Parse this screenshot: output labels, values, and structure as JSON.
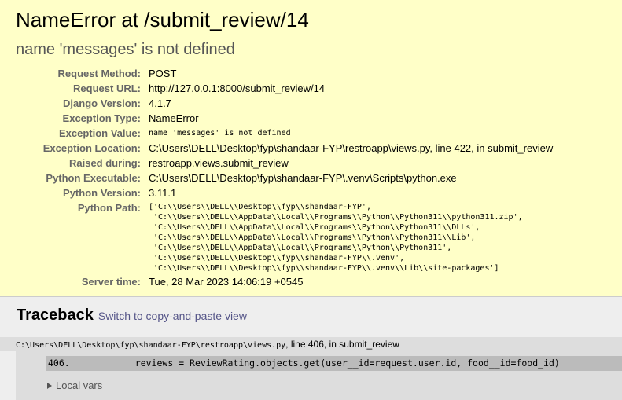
{
  "error": {
    "title": "NameError at /submit_review/14",
    "message": "name 'messages' is not defined"
  },
  "meta": [
    {
      "label": "Request Method:",
      "value": "POST",
      "mono": false
    },
    {
      "label": "Request URL:",
      "value": "http://127.0.0.1:8000/submit_review/14",
      "mono": false
    },
    {
      "label": "Django Version:",
      "value": "4.1.7",
      "mono": false
    },
    {
      "label": "Exception Type:",
      "value": "NameError",
      "mono": false
    },
    {
      "label": "Exception Value:",
      "value": "name 'messages' is not defined",
      "mono": true
    },
    {
      "label": "Exception Location:",
      "value": "C:\\Users\\DELL\\Desktop\\fyp\\shandaar-FYP\\restroapp\\views.py, line 422, in submit_review",
      "mono": false
    },
    {
      "label": "Raised during:",
      "value": "restroapp.views.submit_review",
      "mono": false
    },
    {
      "label": "Python Executable:",
      "value": "C:\\Users\\DELL\\Desktop\\fyp\\shandaar-FYP\\.venv\\Scripts\\python.exe",
      "mono": false
    },
    {
      "label": "Python Version:",
      "value": "3.11.1",
      "mono": false
    }
  ],
  "python_path": {
    "label": "Python Path:",
    "lines": [
      "['C:\\\\Users\\\\DELL\\\\Desktop\\\\fyp\\\\shandaar-FYP',",
      " 'C:\\\\Users\\\\DELL\\\\AppData\\\\Local\\\\Programs\\\\Python\\\\Python311\\\\python311.zip',",
      " 'C:\\\\Users\\\\DELL\\\\AppData\\\\Local\\\\Programs\\\\Python\\\\Python311\\\\DLLs',",
      " 'C:\\\\Users\\\\DELL\\\\AppData\\\\Local\\\\Programs\\\\Python\\\\Python311\\\\Lib',",
      " 'C:\\\\Users\\\\DELL\\\\AppData\\\\Local\\\\Programs\\\\Python\\\\Python311',",
      " 'C:\\\\Users\\\\DELL\\\\Desktop\\\\fyp\\\\shandaar-FYP\\\\.venv',",
      " 'C:\\\\Users\\\\DELL\\\\Desktop\\\\fyp\\\\shandaar-FYP\\\\.venv\\\\Lib\\\\site-packages']"
    ]
  },
  "server_time": {
    "label": "Server time:",
    "value": "Tue, 28 Mar 2023 14:06:19 +0545"
  },
  "traceback": {
    "heading": "Traceback",
    "switch_link": "Switch to copy-and-paste view",
    "frame": {
      "file": "C:\\Users\\DELL\\Desktop\\fyp\\shandaar-FYP\\restroapp\\views.py",
      "location": ", line 406, in submit_review",
      "line_no": "406.",
      "code": "            reviews = ReviewRating.objects.get(user__id=request.user.id, food__id=food_id)",
      "local_vars_label": "Local vars"
    }
  }
}
